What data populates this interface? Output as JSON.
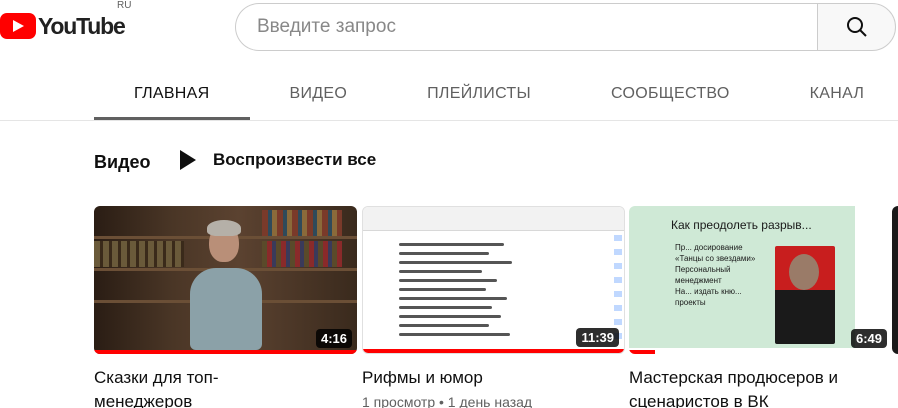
{
  "header": {
    "logo_text": "YouTube",
    "region": "RU",
    "search_placeholder": "Введите запрос",
    "search_icon": "search-icon"
  },
  "tabs": [
    {
      "label": "ГЛАВНАЯ",
      "active": true
    },
    {
      "label": "ВИДЕО",
      "active": false
    },
    {
      "label": "ПЛЕЙЛИСТЫ",
      "active": false
    },
    {
      "label": "СООБЩЕСТВО",
      "active": false
    },
    {
      "label": "КАНАЛ",
      "active": false
    }
  ],
  "section": {
    "title": "Видео",
    "play_all_label": "Воспроизвести все",
    "play_icon": "play-icon"
  },
  "videos": [
    {
      "title_line1": "Сказки для топ-",
      "title_line2": "менеджеров",
      "duration": "4:16",
      "watched_fraction": 1.0,
      "meta": ""
    },
    {
      "title_line1": "Рифмы и юмор",
      "title_line2": "",
      "duration": "11:39",
      "watched_fraction": 1.0,
      "meta": "1 просмотр • 1 день назад"
    },
    {
      "title_line1": "Мастерская продюсеров и",
      "title_line2": "сценаристов в ВК",
      "duration": "6:49",
      "watched_fraction": 0.1,
      "meta": ""
    }
  ],
  "slide": {
    "title": "Как преодолеть разрыв...",
    "items": [
      "Пр... досирование",
      "«Танцы со звездами»",
      "Персональный менеджмент",
      "На... издать кню... проекты"
    ]
  },
  "colors": {
    "accent": "#ff0000",
    "text_primary": "#0f0f0f",
    "text_secondary": "#606060"
  }
}
